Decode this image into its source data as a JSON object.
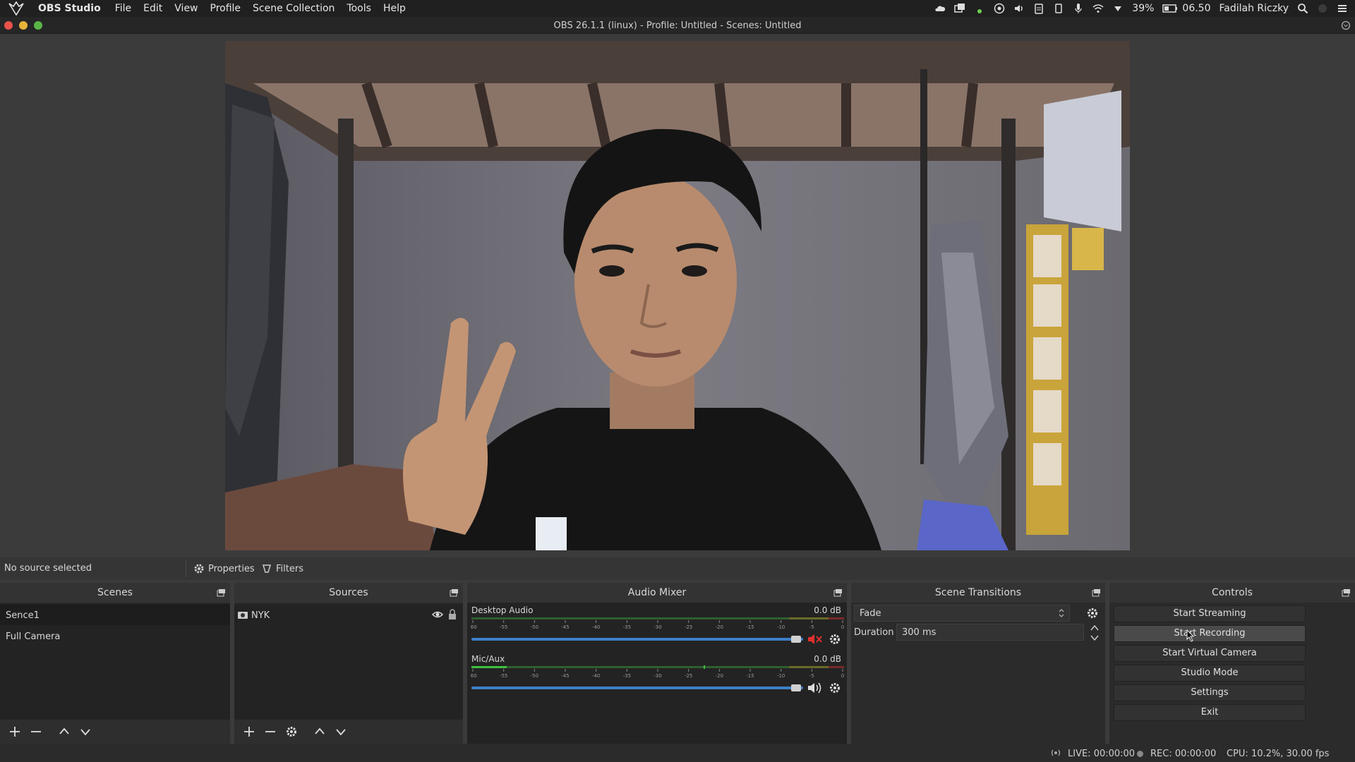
{
  "system_bar": {
    "app_name": "OBS Studio",
    "menu": [
      "File",
      "Edit",
      "View",
      "Profile",
      "Scene Collection",
      "Tools",
      "Help"
    ],
    "battery": "39%",
    "clock": "06.50",
    "user": "Fadilah Riczky"
  },
  "window": {
    "title": "OBS 26.1.1 (linux) - Profile: Untitled - Scenes: Untitled"
  },
  "context_bar": {
    "no_source": "No source selected",
    "properties": "Properties",
    "filters": "Filters"
  },
  "scenes": {
    "title": "Scenes",
    "items": [
      "Sence1",
      "Full Camera"
    ]
  },
  "sources": {
    "title": "Sources",
    "items": [
      {
        "name": "NYK",
        "icon": "camera-icon",
        "visible": true,
        "locked": false
      }
    ]
  },
  "audio_mixer": {
    "title": "Audio Mixer",
    "ticks": [
      "-60",
      "-55",
      "-50",
      "-45",
      "-40",
      "-35",
      "-30",
      "-25",
      "-20",
      "-15",
      "-10",
      "-5",
      "0"
    ],
    "channels": [
      {
        "name": "Desktop Audio",
        "db": "0.0 dB",
        "muted": true,
        "volume": 1.0
      },
      {
        "name": "Mic/Aux",
        "db": "0.0 dB",
        "muted": false,
        "volume": 1.0
      }
    ]
  },
  "transitions": {
    "title": "Scene Transitions",
    "selected": "Fade",
    "duration_label": "Duration",
    "duration": "300 ms"
  },
  "controls": {
    "title": "Controls",
    "buttons": [
      "Start Streaming",
      "Start Recording",
      "Start Virtual Camera",
      "Studio Mode",
      "Settings",
      "Exit"
    ]
  },
  "status": {
    "live": "LIVE: 00:00:00",
    "rec": "REC: 00:00:00",
    "cpu": "CPU: 10.2%, 30.00 fps"
  },
  "colors": {
    "window_bg": "#3b3b3b",
    "panel_bg": "#2b2b2b",
    "accent_blue": "#3d80c9",
    "meter_green": "#3fbf3f",
    "meter_yellow": "#c8c83c",
    "meter_red": "#c83c3c",
    "mute_red": "#e03030"
  }
}
